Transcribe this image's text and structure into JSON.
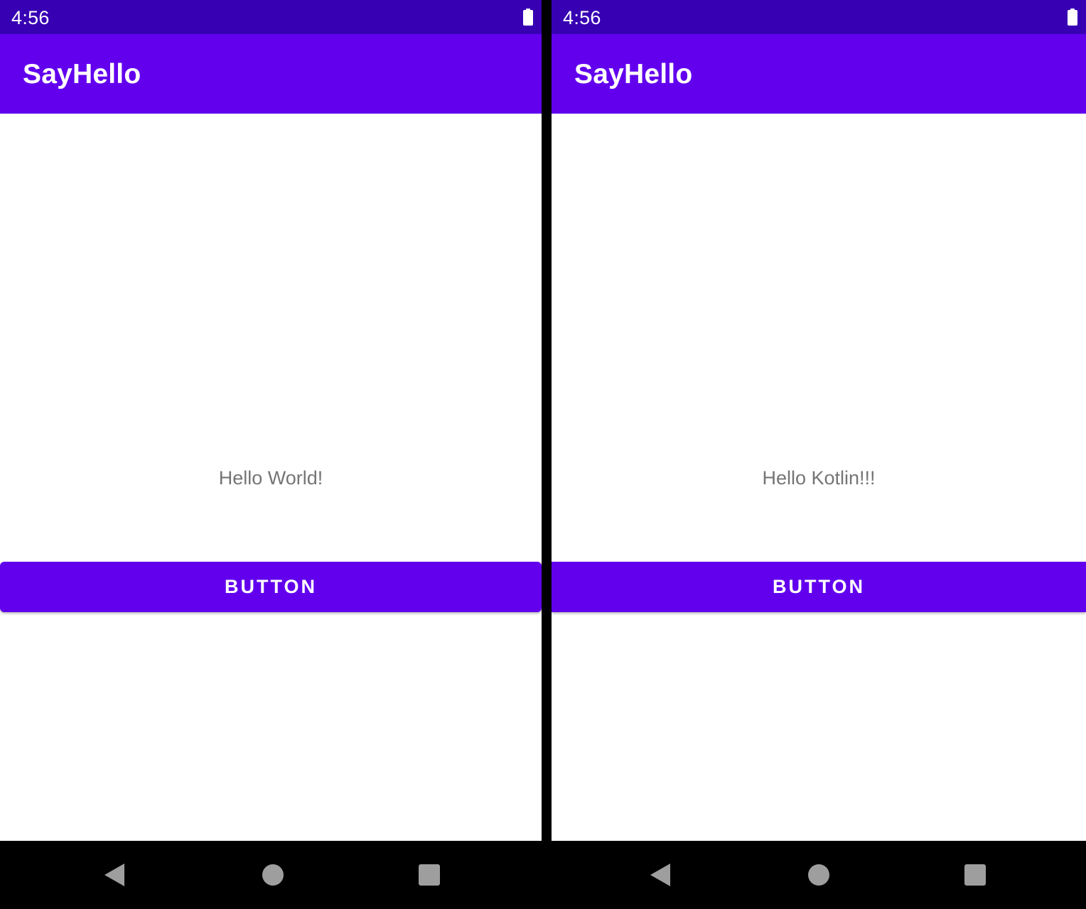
{
  "screens": [
    {
      "status_bar": {
        "time": "4:56",
        "battery_icon": "battery-full-icon"
      },
      "app_bar": {
        "title": "SayHello"
      },
      "content": {
        "message": "Hello World!",
        "button_label": "BUTTON"
      },
      "nav_bar": {
        "back_icon": "back-triangle-icon",
        "home_icon": "home-circle-icon",
        "recents_icon": "recents-square-icon"
      }
    },
    {
      "status_bar": {
        "time": "4:56",
        "battery_icon": "battery-full-icon"
      },
      "app_bar": {
        "title": "SayHello"
      },
      "content": {
        "message": "Hello Kotlin!!!",
        "button_label": "BUTTON"
      },
      "nav_bar": {
        "back_icon": "back-triangle-icon",
        "home_icon": "home-circle-icon",
        "recents_icon": "recents-square-icon"
      }
    }
  ],
  "colors": {
    "status_bar": "#3700B3",
    "primary": "#6200EE",
    "message_text": "#757575",
    "nav_icon": "#9e9e9e",
    "background": "#ffffff"
  }
}
